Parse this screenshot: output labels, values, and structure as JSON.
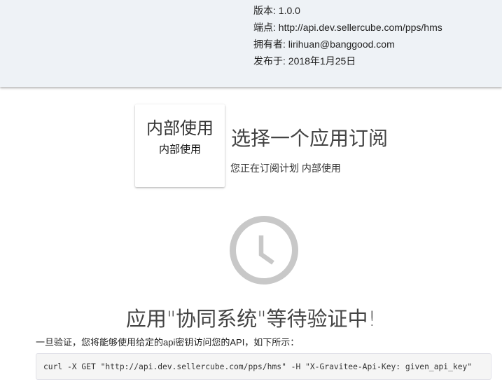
{
  "api_info": {
    "version": "版本: 1.0.0",
    "endpoint": "端点: http://api.dev.sellercube.com/pps/hms",
    "owner": "拥有者: lirihuan@banggood.com",
    "published": "发布于: 2018年1月25日"
  },
  "plan_card": {
    "title": "内部使用",
    "subtitle": "内部使用"
  },
  "subscribe": {
    "title": "选择一个应用订阅",
    "description": "您正在订阅计划 内部使用"
  },
  "pending": {
    "icon": "clock-icon",
    "title": "应用\"协同系统\"等待验证中!",
    "hint": "一旦验证，您将能够使用给定的api密钥访问您的API，如下所示：",
    "code": "curl -X GET \"http://api.dev.sellercube.com/pps/hms\" -H \"X-Gravitee-Api-Key: given_api_key\""
  },
  "colors": {
    "header_bg": "#eef2f6",
    "clock": "#c8c8c8",
    "code_bg": "#f5f5f5"
  }
}
